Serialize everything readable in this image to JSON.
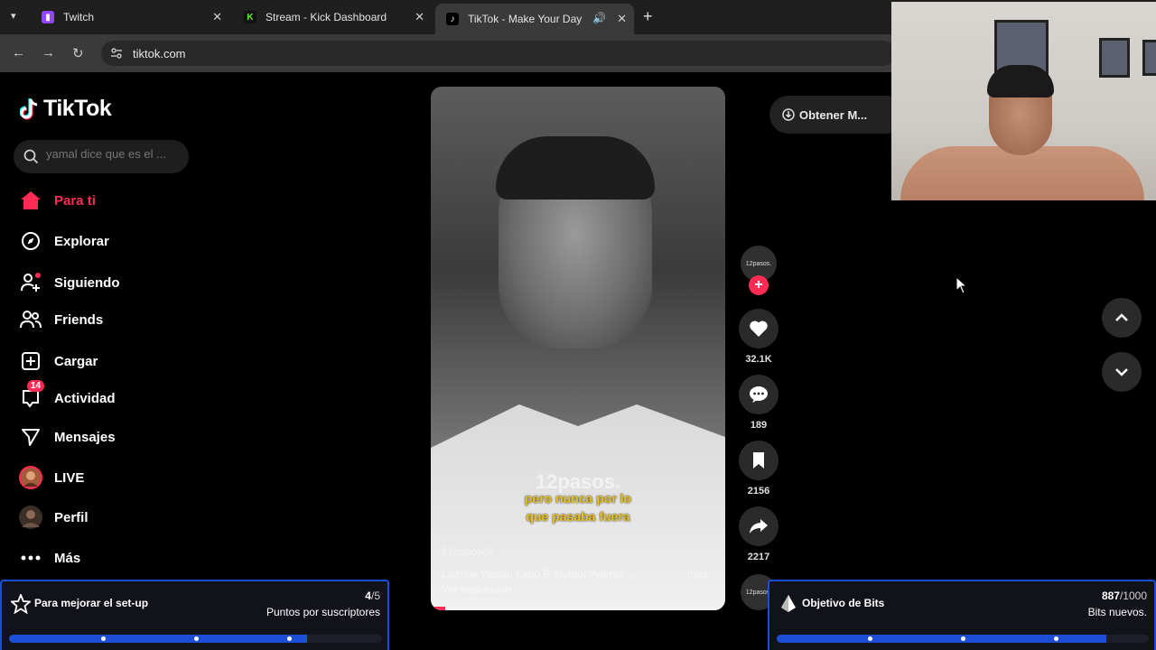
{
  "browser": {
    "tabs": [
      {
        "label": "Twitch",
        "icon": "twitch-icon",
        "color": "#9146ff"
      },
      {
        "label": "Stream - Kick Dashboard",
        "icon": "kick-icon",
        "color": "#53fc18"
      },
      {
        "label": "TikTok - Make Your Day",
        "icon": "tiktok-icon",
        "color": "#ffffff"
      }
    ],
    "url": "tiktok.com"
  },
  "sidebar": {
    "logo": "TikTok",
    "search_placeholder": "yamal dice que es el ...",
    "items": [
      {
        "label": "Para ti",
        "icon": "home-icon",
        "active": true
      },
      {
        "label": "Explorar",
        "icon": "compass-icon"
      },
      {
        "label": "Siguiendo",
        "icon": "following-icon"
      },
      {
        "label": "Friends",
        "icon": "friends-icon"
      },
      {
        "label": "Cargar",
        "icon": "upload-icon"
      },
      {
        "label": "Actividad",
        "icon": "activity-icon",
        "badge": "14"
      },
      {
        "label": "Mensajes",
        "icon": "messages-icon"
      },
      {
        "label": "LIVE",
        "icon": "live-icon"
      },
      {
        "label": "Perfil",
        "icon": "profile-icon"
      },
      {
        "label": "Más",
        "icon": "more-icon"
      }
    ]
  },
  "video": {
    "watermark": "12pasos.",
    "caption_line1": "pero nunca por lo",
    "caption_line2": "que pasaba fuera",
    "author": "12pasosok",
    "description": "Lamine Yamal: Lado B #futbol #yamal ...",
    "more": "más",
    "translation": "Ver traducción",
    "progress": 0.05
  },
  "actions": {
    "avatar_label": "12pasos.",
    "likes": "32.1K",
    "comments": "189",
    "saves": "2156",
    "shares": "2217",
    "next_avatar_label": "12pasos."
  },
  "get_app": "Obtener M...",
  "goals": {
    "left": {
      "title": "Para mejorar el set-up",
      "current": "4",
      "target": "/5",
      "subtitle": "Puntos por suscriptores",
      "progress": 0.8
    },
    "right": {
      "title": "Objetivo de Bits",
      "current": "887",
      "target": "/1000",
      "subtitle": "Bits nuevos.",
      "progress": 0.887
    }
  },
  "colors": {
    "accent": "#fe2c55",
    "goal_blue": "#1d4fd6"
  }
}
